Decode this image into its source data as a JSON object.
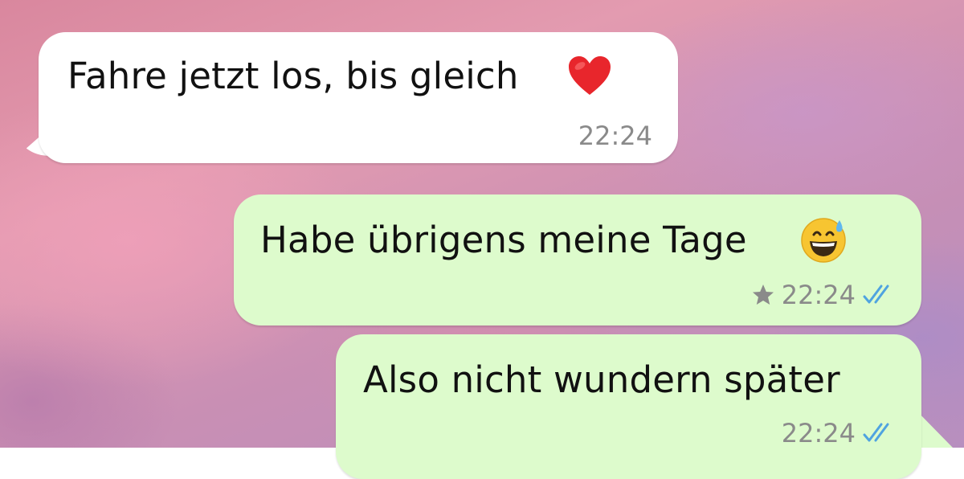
{
  "messages": [
    {
      "direction": "incoming",
      "text": "Fahre jetzt los, bis gleich",
      "emoji": "red-heart",
      "time": "22:24"
    },
    {
      "direction": "outgoing",
      "text": "Habe übrigens meine Tage",
      "emoji": "grinning-face-with-sweat",
      "time": "22:24",
      "starred": true,
      "status": "read"
    },
    {
      "direction": "outgoing",
      "text": "Also nicht wundern später",
      "time": "22:24",
      "status": "read"
    }
  ],
  "colors": {
    "incoming_bubble": "#ffffff",
    "outgoing_bubble": "#ddfbcc",
    "read_ticks": "#4fa3e0",
    "meta_text": "#8a8a8a"
  }
}
